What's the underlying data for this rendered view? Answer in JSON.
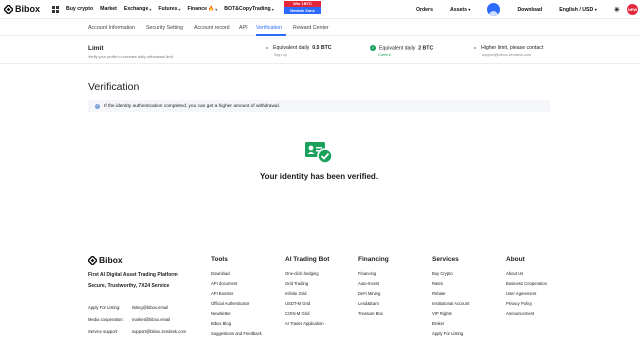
{
  "topbar": {
    "brand": "Bibox",
    "nav": [
      {
        "label": "Buy crypto",
        "chevron": false,
        "fire": false
      },
      {
        "label": "Market",
        "chevron": false,
        "fire": false
      },
      {
        "label": "Exchange",
        "chevron": true,
        "fire": false
      },
      {
        "label": "Futures",
        "chevron": true,
        "fire": false
      },
      {
        "label": "Finance",
        "chevron": true,
        "fire": true
      },
      {
        "label": "BOT&CopyTrading",
        "chevron": true,
        "fire": false
      }
    ],
    "promo_top": "Win 1BTC",
    "promo_bottom": "Newbie Zone",
    "right": {
      "orders": "Orders",
      "assets": "Assets",
      "download": "Download",
      "locale": "English / USD",
      "new_badge": "NEW"
    },
    "accent": "#2d6bff"
  },
  "subnav": {
    "tabs": [
      {
        "label": "Account Information",
        "active": false
      },
      {
        "label": "Security Setting",
        "active": false
      },
      {
        "label": "Account record",
        "active": false
      },
      {
        "label": "API",
        "active": false
      },
      {
        "label": "Verification",
        "active": true
      },
      {
        "label": "Reward Center",
        "active": false
      }
    ]
  },
  "limit": {
    "title": "Limit",
    "subtitle": "Verify your profile to increase daily withdrawal limit.",
    "steps": [
      {
        "label": "Equivalent daily",
        "amount": "0.5 BTC",
        "sub": "Sign up",
        "status": "dot"
      },
      {
        "label": "Equivalent daily",
        "amount": "2 BTC",
        "sub": "Current",
        "status": "check"
      },
      {
        "label": "Higher limit, please contact",
        "amount": "",
        "sub": "support@bibox.zendesk.com",
        "status": "dot"
      }
    ]
  },
  "verification": {
    "title": "Verification",
    "notice": "If the identity authentication completed, you can get a higher amount of withdrawal.",
    "status_text": "Your identity has been verified.",
    "success_color": "#1aa25c"
  },
  "footer": {
    "brand": "Bibox",
    "tagline1": "First AI Digital Asset Trading Platform",
    "tagline2": "Secure, Trustworthy, 7X24 Service",
    "contacts": [
      {
        "label": "Apply For Listing:",
        "value": "listing@bibox.email"
      },
      {
        "label": "Media cooperation:",
        "value": "market@bibox.email"
      },
      {
        "label": "Service support:",
        "value": "support@bibox.zendesk.com"
      }
    ],
    "columns": [
      {
        "heading": "Tools",
        "links": [
          "Download",
          "API document",
          "API Booster",
          "Official Authenticator",
          "Newsletter",
          "Bibox Blog",
          "Suggestions and Feedback"
        ]
      },
      {
        "heading": "AI Trading Bot",
        "links": [
          "One-click hedging",
          "Grid Trading",
          "Infinite Grid",
          "USDT-M Grid",
          "COIN-M Grid",
          "AI Trader Application"
        ]
      },
      {
        "heading": "Financing",
        "links": [
          "Financing",
          "Auto-Invest",
          "DeFi Mining",
          "Lend&Earn",
          "Treasure Box"
        ]
      },
      {
        "heading": "Services",
        "links": [
          "Buy Crypto",
          "Rates",
          "Rebate",
          "Institutional Account",
          "VIP Rights",
          "Broker",
          "Apply For Listing"
        ]
      },
      {
        "heading": "About",
        "links": [
          "About Us",
          "Business Cooperation",
          "User Agreement",
          "Privacy Policy",
          "Announcement"
        ]
      }
    ]
  }
}
